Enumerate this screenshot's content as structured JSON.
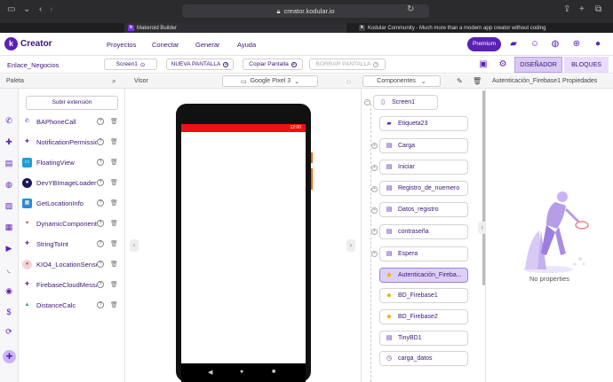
{
  "browser": {
    "url": "creator.kodular.io",
    "tabs": [
      {
        "title": "Makeroid Builder",
        "favicon": "k"
      },
      {
        "title": "Kodular Community - Much more than a modern app creator without coding",
        "favicon": "k"
      }
    ]
  },
  "header": {
    "brand": "Creator",
    "menu": [
      "Proyectos",
      "Conectar",
      "Generar",
      "Ayuda"
    ],
    "premium_label": "Premium",
    "accent": "#5b21b6"
  },
  "project": {
    "name": "Enlace_Negocios",
    "screen_select": "Screen1",
    "new_screen": "NUEVA PANTALLA",
    "copy_screen": "Copiar Pantalla",
    "delete_screen": "BORRAR PANTALLA",
    "designer": "DISEÑADOR",
    "blocks": "BLOQUES"
  },
  "palette": {
    "title": "Paleta",
    "upload_extension": "Subir extensión",
    "items": [
      {
        "name": "BAPhoneCall",
        "icon": "phone-icon",
        "color": "#5b21b6"
      },
      {
        "name": "NotificationPermission",
        "icon": "puzzle-icon",
        "color": "#5b21b6"
      },
      {
        "name": "FloatingView",
        "icon": "window-icon",
        "color": "#1aa0d8"
      },
      {
        "name": "DevYBImageLoader",
        "icon": "camera-icon",
        "color": "#1a1a5a"
      },
      {
        "name": "GetLocationInfo",
        "icon": "map-icon",
        "color": "#2a8ad8"
      },
      {
        "name": "DynamicComponents",
        "icon": "heart-icon",
        "color": "#e8552a"
      },
      {
        "name": "StringToInt",
        "icon": "puzzle-icon",
        "color": "#5b21b6"
      },
      {
        "name": "KIO4_LocationSensor",
        "icon": "pin-icon",
        "color": "#e8a0a0"
      },
      {
        "name": "FirebaseCloudMessaging",
        "icon": "puzzle-icon",
        "color": "#5b21b6"
      },
      {
        "name": "DistanceCalc",
        "icon": "mountain-icon",
        "color": "#3aa060"
      }
    ]
  },
  "viewer": {
    "title": "Visor",
    "device": "Google Pixel 3",
    "status_time": "12:00"
  },
  "components": {
    "title": "Componentes",
    "items": [
      {
        "name": "Screen1",
        "icon": "phone-icon"
      },
      {
        "name": "Etiqueta23",
        "icon": "label-icon"
      },
      {
        "name": "Carga",
        "icon": "db-icon"
      },
      {
        "name": "Iniciar",
        "icon": "db-icon"
      },
      {
        "name": "Registro_de_nuemero",
        "icon": "db-icon"
      },
      {
        "name": "Datos_registro",
        "icon": "db-icon"
      },
      {
        "name": "contraseña",
        "icon": "db-icon"
      },
      {
        "name": "Espera",
        "icon": "db-icon"
      },
      {
        "name": "Autenticación_Fireba...",
        "icon": "firebase-icon"
      },
      {
        "name": "BD_Firebase1",
        "icon": "firebase-icon"
      },
      {
        "name": "BD_Firebase2",
        "icon": "firebase-icon"
      },
      {
        "name": "TinyBD1",
        "icon": "db-icon"
      },
      {
        "name": "carga_datos",
        "icon": "clock-icon"
      }
    ]
  },
  "properties": {
    "title": "Autenticación_Firebase1 Propiedades",
    "empty_text": "No properties"
  }
}
